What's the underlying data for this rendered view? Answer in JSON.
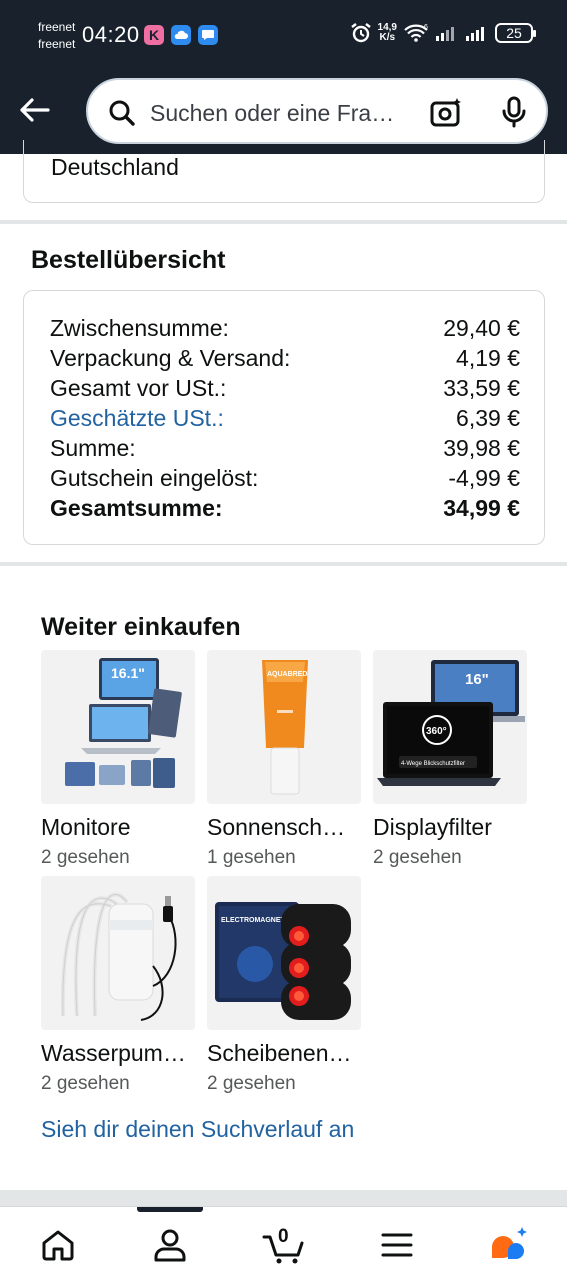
{
  "status_bar": {
    "carrier_1": "freenet",
    "carrier_2": "freenet",
    "time": "04:20",
    "notif_k": "K",
    "net_speed_value": "14,9",
    "net_speed_unit": "K/s",
    "wifi_badge": "6",
    "battery": "25"
  },
  "header": {
    "search_placeholder": "Suchen oder eine Frage stellen",
    "search_display": "Suchen oder eine Fra…"
  },
  "address": {
    "country": "Deutschland"
  },
  "order_summary": {
    "title": "Bestellübersicht",
    "rows": [
      {
        "label": "Zwischensumme:",
        "value": "29,40 €"
      },
      {
        "label": "Verpackung & Versand:",
        "value": "4,19 €"
      },
      {
        "label": "Gesamt vor USt.:",
        "value": "33,59 €"
      },
      {
        "label": "Geschätzte USt.:",
        "value": "6,39 €"
      },
      {
        "label": "Summe:",
        "value": "39,98 €"
      },
      {
        "label": "Gutschein eingelöst:",
        "value": "-4,99 €"
      },
      {
        "label": "Gesamtsumme:",
        "value": "34,99 €"
      }
    ]
  },
  "keep_shopping": {
    "title": "Weiter einkaufen",
    "items": [
      {
        "name": "Monitore",
        "seen": "2 gesehen",
        "badge": "16.1\""
      },
      {
        "name": "Sonnensch…",
        "seen": "1 gesehen",
        "badge": "AQUABRED"
      },
      {
        "name": "Displayfilter",
        "seen": "2 gesehen",
        "badge": "16\"",
        "badge2": "360°",
        "caption": "4-Wege Blickschutzfilter"
      },
      {
        "name": "Wasserpum…",
        "seen": "2 gesehen"
      },
      {
        "name": "Scheibenen…",
        "seen": "2 gesehen",
        "badge": "ELECTROMAGNETIC"
      }
    ],
    "history_link": "Sieh dir deinen Suchverlauf an"
  },
  "bottom_nav": {
    "cart_count": "0"
  },
  "colors": {
    "header_bg": "#19212d",
    "link": "#2162a1",
    "divider": "#e3e6e6",
    "rufus_orange": "#ff6a13",
    "rufus_blue": "#1c7cf4"
  }
}
